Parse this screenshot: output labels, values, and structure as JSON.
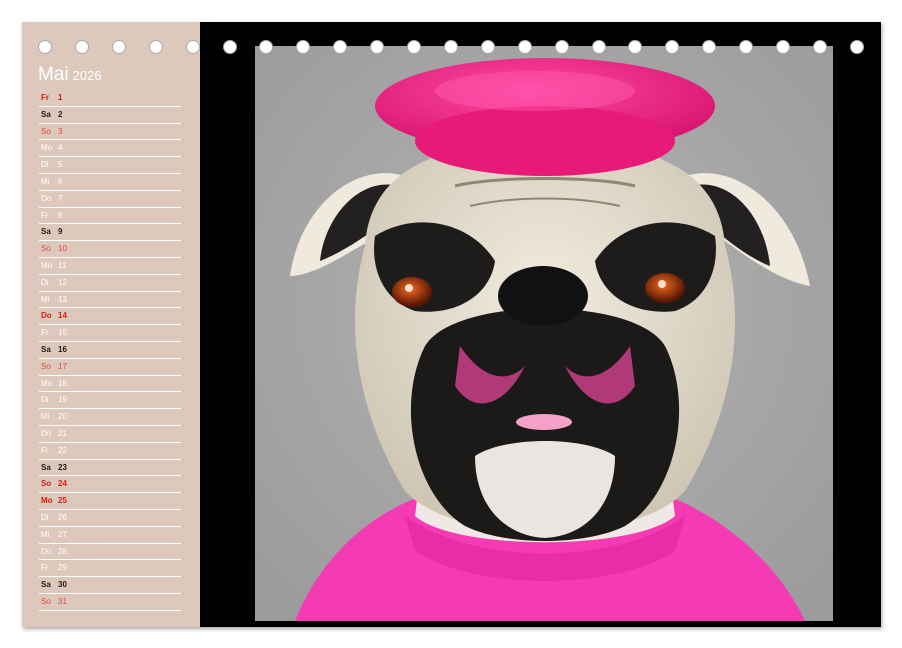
{
  "calendar": {
    "month": "Mai",
    "year": "2026",
    "days": [
      {
        "wd": "Fr",
        "d": "1",
        "t": "holiday"
      },
      {
        "wd": "Sa",
        "d": "2",
        "t": "sat"
      },
      {
        "wd": "So",
        "d": "3",
        "t": "sun"
      },
      {
        "wd": "Mo",
        "d": "4",
        "t": "normal"
      },
      {
        "wd": "Di",
        "d": "5",
        "t": "normal"
      },
      {
        "wd": "Mi",
        "d": "6",
        "t": "normal"
      },
      {
        "wd": "Do",
        "d": "7",
        "t": "normal"
      },
      {
        "wd": "Fr",
        "d": "8",
        "t": "normal"
      },
      {
        "wd": "Sa",
        "d": "9",
        "t": "sat"
      },
      {
        "wd": "So",
        "d": "10",
        "t": "sun"
      },
      {
        "wd": "Mo",
        "d": "11",
        "t": "normal"
      },
      {
        "wd": "Di",
        "d": "12",
        "t": "normal"
      },
      {
        "wd": "Mi",
        "d": "13",
        "t": "normal"
      },
      {
        "wd": "Do",
        "d": "14",
        "t": "holiday"
      },
      {
        "wd": "Fr",
        "d": "15",
        "t": "normal"
      },
      {
        "wd": "Sa",
        "d": "16",
        "t": "sat"
      },
      {
        "wd": "So",
        "d": "17",
        "t": "sun"
      },
      {
        "wd": "Mo",
        "d": "18",
        "t": "normal"
      },
      {
        "wd": "Di",
        "d": "19",
        "t": "normal"
      },
      {
        "wd": "Mi",
        "d": "20",
        "t": "normal"
      },
      {
        "wd": "Do",
        "d": "21",
        "t": "normal"
      },
      {
        "wd": "Fr",
        "d": "22",
        "t": "normal"
      },
      {
        "wd": "Sa",
        "d": "23",
        "t": "sat"
      },
      {
        "wd": "So",
        "d": "24",
        "t": "holiday"
      },
      {
        "wd": "Mo",
        "d": "25",
        "t": "holiday"
      },
      {
        "wd": "Di",
        "d": "26",
        "t": "normal"
      },
      {
        "wd": "Mi",
        "d": "27",
        "t": "normal"
      },
      {
        "wd": "Do",
        "d": "28",
        "t": "normal"
      },
      {
        "wd": "Fr",
        "d": "29",
        "t": "normal"
      },
      {
        "wd": "Sa",
        "d": "30",
        "t": "sat"
      },
      {
        "wd": "So",
        "d": "31",
        "t": "sun"
      }
    ]
  },
  "colors": {
    "sidebar": "#dcc9bb",
    "frame": "#000000",
    "photo_background": "#a9a8a8",
    "beret": "#f0187e",
    "shirt": "#f53bb4",
    "weekday_text": "#ffffff",
    "saturday_text": "#1a1a1a",
    "sunday_text": "#e0463a",
    "holiday_text": "#d81c10"
  },
  "photo": {
    "subject": "english-bulldog-with-pink-beret-and-pink-sweater"
  }
}
